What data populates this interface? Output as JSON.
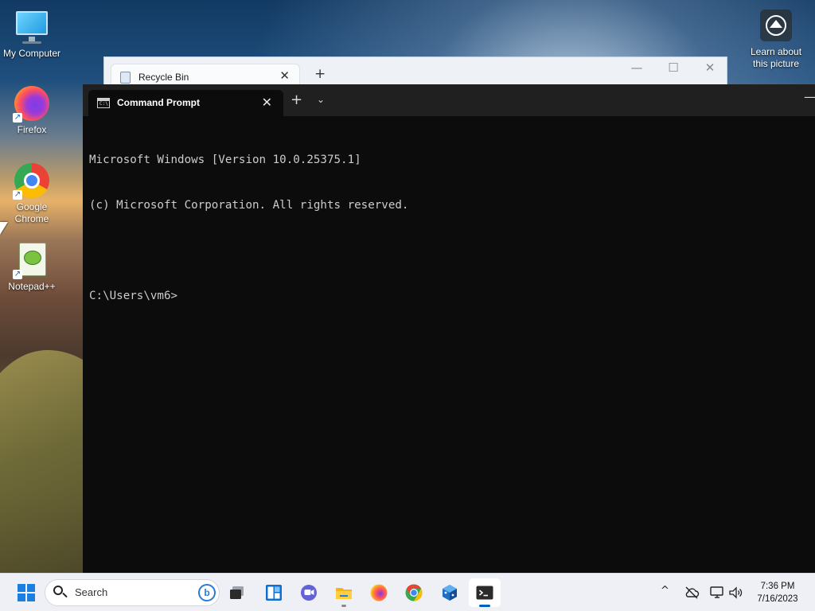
{
  "desktop": {
    "icons": [
      {
        "label": "My Computer",
        "icon": "computer-icon"
      },
      {
        "label": "Firefox",
        "icon": "firefox-icon"
      },
      {
        "label": "Google Chrome",
        "icon": "chrome-icon"
      },
      {
        "label": "Notepad++",
        "icon": "notepad-plus-plus-icon"
      }
    ],
    "learn_picture": {
      "label_line1": "Learn about",
      "label_line2": "this picture"
    }
  },
  "explorer_window": {
    "tab_label": "Recycle Bin",
    "close_glyph": "✕",
    "new_tab_glyph": "+",
    "controls": {
      "minimize": "—",
      "maximize": "☐",
      "close": "✕"
    }
  },
  "terminal": {
    "tab_label": "Command Prompt",
    "tab_icon_text": "C:\\",
    "close_glyph": "✕",
    "new_tab_glyph": "+",
    "dropdown_glyph": "⌄",
    "minimize_glyph": "—",
    "console_lines": [
      "Microsoft Windows [Version 10.0.25375.1]",
      "(c) Microsoft Corporation. All rights reserved.",
      "",
      "C:\\Users\\vm6>"
    ]
  },
  "taskbar": {
    "search_placeholder": "Search",
    "bing_glyph": "b",
    "apps": [
      {
        "name": "start",
        "icon": "windows-start-icon"
      },
      {
        "name": "task-view",
        "icon": "task-view-icon"
      },
      {
        "name": "widgets",
        "icon": "widgets-icon"
      },
      {
        "name": "chat",
        "icon": "teams-chat-icon"
      },
      {
        "name": "file-explorer",
        "icon": "folder-icon",
        "running": true
      },
      {
        "name": "firefox",
        "icon": "firefox-icon"
      },
      {
        "name": "chrome",
        "icon": "chrome-icon"
      },
      {
        "name": "azure-data-studio",
        "icon": "cube-app-icon"
      },
      {
        "name": "terminal",
        "icon": "terminal-icon",
        "active": true
      }
    ],
    "tray": {
      "chevron_glyph": "^",
      "clock_time": "7:36 PM",
      "clock_date": "7/16/2023"
    }
  },
  "colors": {
    "terminal_bg": "#0c0c0c",
    "terminal_titlebar": "#202020",
    "console_text": "#cccccc",
    "taskbar_bg": "#eef0f5",
    "accent": "#005fb8"
  }
}
